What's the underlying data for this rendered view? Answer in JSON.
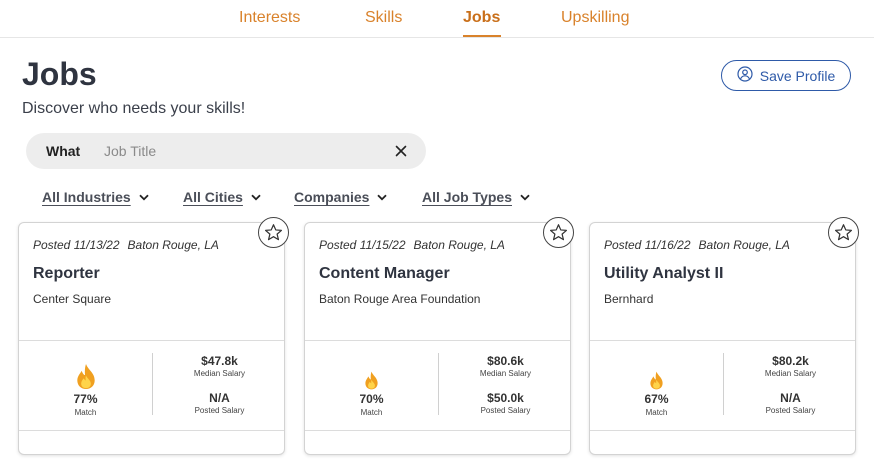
{
  "nav": {
    "tabs": [
      {
        "label": "Interests"
      },
      {
        "label": "Skills"
      },
      {
        "label": "Jobs"
      },
      {
        "label": "Upskilling"
      }
    ],
    "active_tab": "Jobs"
  },
  "header": {
    "title": "Jobs",
    "subtitle": "Discover who needs your skills!",
    "save_profile_label": "Save Profile"
  },
  "search": {
    "label": "What",
    "placeholder": "Job Title",
    "value": ""
  },
  "filters": [
    {
      "label": "All Industries"
    },
    {
      "label": "All Cities"
    },
    {
      "label": "Companies"
    },
    {
      "label": "All Job Types"
    }
  ],
  "jobs": [
    {
      "posted": "Posted 11/13/22",
      "location": "Baton Rouge, LA",
      "title": "Reporter",
      "company": "Center Square",
      "match": "77%",
      "match_label": "Match",
      "median_salary": "$47.8k",
      "median_label": "Median Salary",
      "posted_salary": "N/A",
      "posted_salary_label": "Posted Salary",
      "icon": "fire-icon"
    },
    {
      "posted": "Posted 11/15/22",
      "location": "Baton Rouge, LA",
      "title": "Content Manager",
      "company": "Baton Rouge Area Foundation",
      "match": "70%",
      "match_label": "Match",
      "median_salary": "$80.6k",
      "median_label": "Median Salary",
      "posted_salary": "$50.0k",
      "posted_salary_label": "Posted Salary",
      "icon": "fire-icon"
    },
    {
      "posted": "Posted 11/16/22",
      "location": "Baton Rouge, LA",
      "title": "Utility Analyst II",
      "company": "Bernhard",
      "match": "67%",
      "match_label": "Match",
      "median_salary": "$80.2k",
      "median_label": "Median Salary",
      "posted_salary": "N/A",
      "posted_salary_label": "Posted Salary",
      "icon": "fire-icon"
    }
  ],
  "colors": {
    "accent": "#d9822b",
    "link_blue": "#2e5aa8",
    "fire_outer": "#f0a020",
    "fire_inner": "#ffd44a"
  }
}
